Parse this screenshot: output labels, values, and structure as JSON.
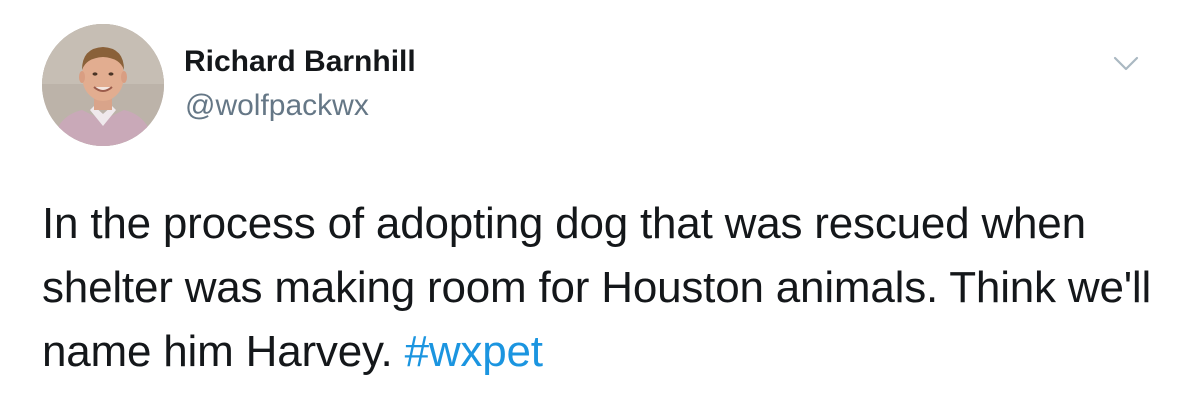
{
  "tweet": {
    "author": {
      "display_name": "Richard Barnhill",
      "handle": "@wolfpackwx",
      "avatar_icon": "user-avatar-photo"
    },
    "menu_icon": "chevron-down-icon",
    "text": "In the process of adopting dog that was rescued when shelter was making room for Houston animals. Think we'll name him Harvey.",
    "hashtag": "#wxpet"
  },
  "colors": {
    "text": "#14171a",
    "handle": "#657786",
    "link": "#1b95e0",
    "chevron": "#aab8c2"
  }
}
